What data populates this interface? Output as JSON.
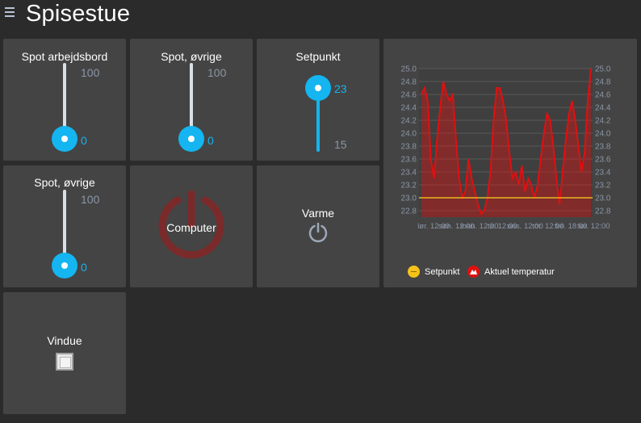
{
  "header": {
    "title": "Spisestue",
    "menu_icon": "hamburger-menu-icon"
  },
  "tiles": {
    "spot_arbejdsbord": {
      "label": "Spot arbejdsbord",
      "max": "100",
      "value": "0",
      "level": 0
    },
    "spot_ovrige_1": {
      "label": "Spot, øvrige",
      "max": "100",
      "value": "0",
      "level": 0
    },
    "setpunkt": {
      "label": "Setpunkt",
      "value": "23",
      "min": "15",
      "level": 0.9
    },
    "spot_ovrige_2": {
      "label": "Spot, øvrige",
      "max": "100",
      "value": "0",
      "level": 0
    },
    "computer": {
      "label": "Computer",
      "icon": "power-icon",
      "state": "off"
    },
    "varme": {
      "label": "Varme",
      "icon": "power-icon"
    },
    "vindue": {
      "label": "Vindue",
      "checked": false
    }
  },
  "colors": {
    "accent": "#14b5f0",
    "tile_bg": "#444444",
    "page_bg": "#2b2b2b",
    "setpoint_line": "#e8b820",
    "temperature": "#e01010"
  },
  "chart_data": {
    "type": "area",
    "ylim": [
      22.7,
      25.0
    ],
    "yticks": [
      "25.0",
      "24.8",
      "24.6",
      "24.4",
      "24.2",
      "24.0",
      "23.8",
      "23.6",
      "23.4",
      "23.2",
      "23.0",
      "22.8"
    ],
    "xticks": [
      "lør. 12:00",
      "søn. 12:00",
      "man. 12:00",
      "tir. 12:00",
      "ons. 12:00",
      "tor. 12:00",
      "fre. 18:00",
      "lør. 12:00"
    ],
    "grid": true,
    "legend_position": "bottom",
    "series": [
      {
        "name": "Setpunkt",
        "type": "line",
        "color": "#e8b820",
        "values": [
          23.0,
          23.0
        ]
      },
      {
        "name": "Aktuel temperatur",
        "type": "area",
        "color": "#e01010",
        "values": [
          24.6,
          24.7,
          24.5,
          23.6,
          23.3,
          23.9,
          24.4,
          24.8,
          24.6,
          24.5,
          24.6,
          23.9,
          23.3,
          23.0,
          23.1,
          23.6,
          23.3,
          23.1,
          22.9,
          22.75,
          22.8,
          23.0,
          23.4,
          24.2,
          24.7,
          24.7,
          24.5,
          24.2,
          23.7,
          23.3,
          23.4,
          23.2,
          23.5,
          23.1,
          23.3,
          23.2,
          23.0,
          23.2,
          23.6,
          24.0,
          24.3,
          24.2,
          23.8,
          23.3,
          22.9,
          23.4,
          23.9,
          24.3,
          24.5,
          24.2,
          23.8,
          23.4,
          23.7,
          24.5,
          25.0
        ]
      }
    ]
  }
}
